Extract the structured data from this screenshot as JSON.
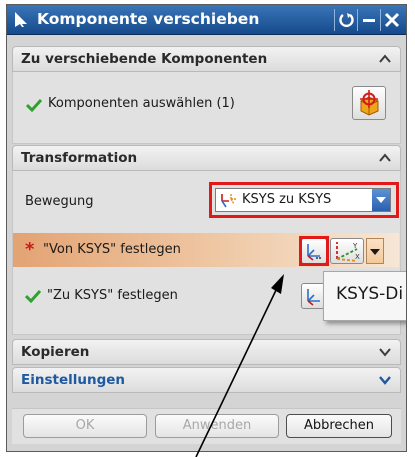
{
  "window": {
    "title": "Komponente verschieben"
  },
  "sections": {
    "components": {
      "title": "Zu verschiebende Komponenten",
      "select_label": "Komponenten auswählen (1)"
    },
    "transformation": {
      "title": "Transformation",
      "movement_label": "Bewegung",
      "movement_value": "KSYS zu KSYS",
      "required_marker": "*",
      "from_label": "\"Von KSYS\" festlegen",
      "to_label": "\"Zu KSYS\" festlegen"
    },
    "copy": {
      "title": "Kopieren"
    },
    "settings": {
      "title": "Einstellungen"
    }
  },
  "tooltip": {
    "text": "KSYS-Di"
  },
  "buttons": {
    "ok": "OK",
    "apply": "Anwenden",
    "cancel": "Abbrechen"
  },
  "colors": {
    "titlebar": "#1f5aa0",
    "highlight": "#e9b185",
    "annotation_frame": "#e11919",
    "check": "#2fa12f"
  }
}
